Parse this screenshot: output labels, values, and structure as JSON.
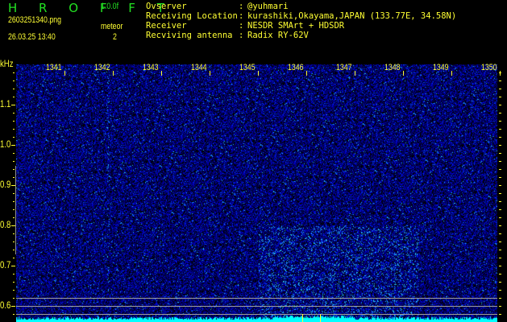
{
  "header": {
    "app_title": "H R O F F T",
    "version": "1.0.0f",
    "filename": "2603251340.png",
    "datetime": "26.03.25 13:40",
    "meteor_label": "meteor",
    "meteor_count": "2"
  },
  "info": [
    {
      "label": "Ovserver",
      "value": "@yuhmari"
    },
    {
      "label": "Receiving Location",
      "value": "kurashiki,Okayama,JAPAN (133.77E, 34.58N)"
    },
    {
      "label": "Receiver",
      "value": "NESDR SMArt + HDSDR"
    },
    {
      "label": "Recviving antenna",
      "value": "Radix RY-62V"
    }
  ],
  "axes": {
    "y_unit": "kHz",
    "x_ticks": [
      "1341",
      "1342",
      "1343",
      "1344",
      "1345",
      "1346",
      "1347",
      "1348",
      "1349",
      "1350"
    ],
    "y_ticks": [
      "1.1",
      "1.0",
      "0.9",
      "0.8",
      "0.7",
      "0.6"
    ]
  },
  "colors": {
    "label": "#ffff33",
    "title": "#22e022",
    "spectrum": "#00ffff",
    "noise": "#0000c8"
  }
}
